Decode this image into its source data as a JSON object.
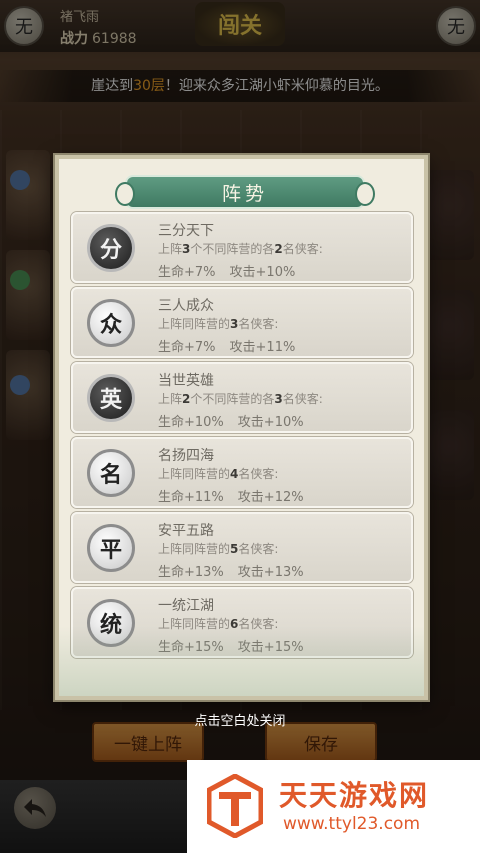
{
  "header": {
    "left_icon_glyph": "无",
    "right_icon_glyph": "无",
    "player_name": "褚飞雨",
    "power_label": "战力",
    "power_value": "61988",
    "badge_text": "闯关"
  },
  "announcement": {
    "prefix": "崖达到",
    "floor": "30层",
    "suffix": "！迎来众多江湖小虾米仰慕的目光。"
  },
  "modal": {
    "title": "阵势",
    "cards": [
      {
        "glyph": "分",
        "coin_style": "dark",
        "name": "三分天下",
        "d1": "上阵",
        "n1": "3",
        "d2": "个不同阵营的各",
        "n2": "2",
        "d3": "名侠客:",
        "hp": "生命+7%",
        "atk": "攻击+10%"
      },
      {
        "glyph": "众",
        "coin_style": "light",
        "name": "三人成众",
        "d1": "上阵同阵营的",
        "n1": "3",
        "d2": "名侠客:",
        "n2": "",
        "d3": "",
        "hp": "生命+7%",
        "atk": "攻击+11%"
      },
      {
        "glyph": "英",
        "coin_style": "dark",
        "name": "当世英雄",
        "d1": "上阵",
        "n1": "2",
        "d2": "个不同阵营的各",
        "n2": "3",
        "d3": "名侠客:",
        "hp": "生命+10%",
        "atk": "攻击+10%"
      },
      {
        "glyph": "名",
        "coin_style": "light",
        "name": "名扬四海",
        "d1": "上阵同阵营的",
        "n1": "4",
        "d2": "名侠客:",
        "n2": "",
        "d3": "",
        "hp": "生命+11%",
        "atk": "攻击+12%"
      },
      {
        "glyph": "平",
        "coin_style": "light",
        "name": "安平五路",
        "d1": "上阵同阵营的",
        "n1": "5",
        "d2": "名侠客:",
        "n2": "",
        "d3": "",
        "hp": "生命+13%",
        "atk": "攻击+13%"
      },
      {
        "glyph": "统",
        "coin_style": "light",
        "name": "一统江湖",
        "d1": "上阵同阵营的",
        "n1": "6",
        "d2": "名侠客:",
        "n2": "",
        "d3": "",
        "hp": "生命+15%",
        "atk": "攻击+15%"
      }
    ]
  },
  "close_hint": "点击空白处关闭",
  "buttons": {
    "auto_deploy": "一键上阵",
    "save": "保存"
  },
  "watermark": {
    "title": "天天游戏网",
    "url": "www.ttyl23.com"
  },
  "colors": {
    "accent_orange": "#f4a62a",
    "ribbon_green": "#4f8a72",
    "watermark_orange": "#e0592a"
  }
}
